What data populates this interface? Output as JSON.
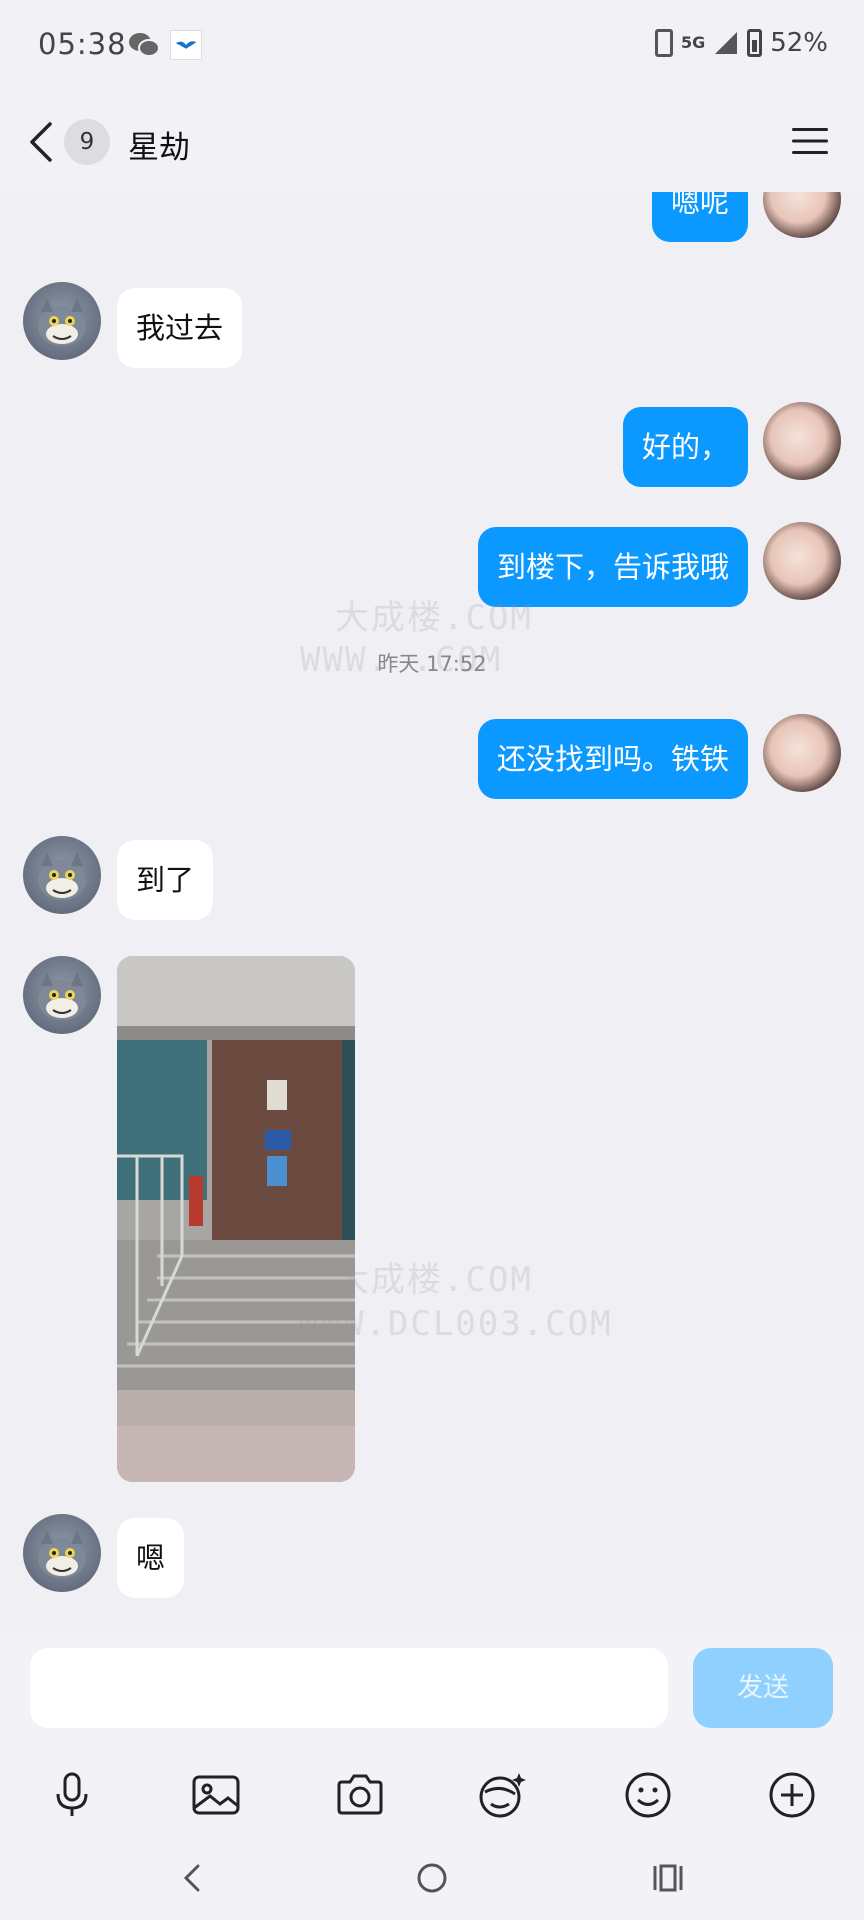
{
  "status_bar": {
    "time": "05:38",
    "network": "5G",
    "battery": "52%"
  },
  "header": {
    "unread_count": "9",
    "title": "星劫"
  },
  "messages": [
    {
      "from": "me",
      "text": "嗯呢"
    },
    {
      "from": "peer",
      "text": "我过去"
    },
    {
      "from": "me",
      "text": "好的，"
    },
    {
      "from": "me",
      "text": "到楼下，告诉我哦"
    },
    {
      "from": "system",
      "text": "昨天 17:52"
    },
    {
      "from": "me",
      "text": "还没找到吗。铁铁"
    },
    {
      "from": "peer",
      "text": "到了"
    },
    {
      "from": "peer",
      "type": "image"
    },
    {
      "from": "peer",
      "text": "嗯"
    }
  ],
  "watermarks": {
    "line1": "大成楼.COM",
    "line2": "WWW.DCL003.COM",
    "line3": "WWW.   .COM"
  },
  "composer": {
    "placeholder": "",
    "send_label": "发送"
  },
  "colors": {
    "accent": "#0b98ff",
    "send_disabled": "#8fd0ff",
    "background": "#efeff4"
  },
  "icons": [
    "microphone-icon",
    "image-icon",
    "camera-icon",
    "sticker-icon",
    "emoji-icon",
    "plus-icon"
  ]
}
